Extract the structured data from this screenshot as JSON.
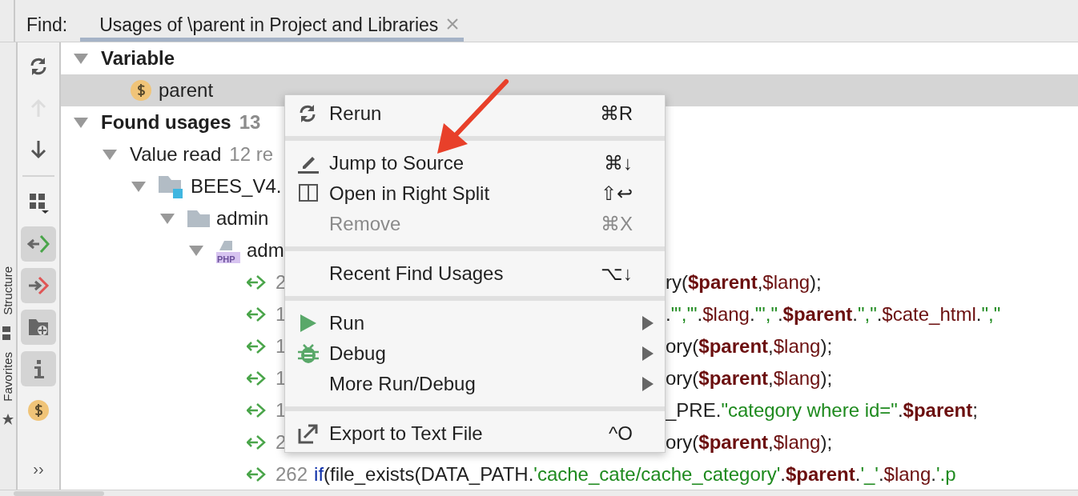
{
  "find_label": "Find:",
  "tab": {
    "label": "Usages of \\parent in Project and Libraries",
    "selected": true
  },
  "side_labels": [
    {
      "label": "Structure",
      "kind": "structure"
    },
    {
      "label": "Favorites",
      "kind": "favorites"
    }
  ],
  "toolbar": [
    {
      "kind": "rerun",
      "pressed": false,
      "disabled": false
    },
    {
      "kind": "up",
      "pressed": false,
      "disabled": true
    },
    {
      "kind": "down",
      "pressed": false,
      "disabled": false
    },
    {
      "kind": "separator"
    },
    {
      "kind": "group",
      "pressed": false,
      "disabled": false
    },
    {
      "kind": "read",
      "pressed": true,
      "disabled": false
    },
    {
      "kind": "write",
      "pressed": true,
      "disabled": false
    },
    {
      "kind": "folder",
      "pressed": true,
      "disabled": false
    },
    {
      "kind": "info",
      "pressed": true,
      "disabled": false
    },
    {
      "kind": "dollar",
      "pressed": false,
      "disabled": false
    }
  ],
  "more": "››",
  "tree": [
    {
      "kind": "heading",
      "label": "Variable",
      "expanded": true,
      "selected": false,
      "children": [
        {
          "kind": "variable",
          "label": "parent",
          "selected": true
        }
      ]
    },
    {
      "kind": "heading",
      "label": "Found usages",
      "count": "13",
      "expanded": true,
      "selected": false,
      "children": [
        {
          "kind": "group",
          "label": "Value read",
          "count": "12 re",
          "expanded": true,
          "selected": false,
          "children": [
            {
              "kind": "module",
              "label": "BEES_V4.",
              "expanded": true,
              "selected": false,
              "children": [
                {
                  "kind": "folder",
                  "label": "admin",
                  "expanded": true,
                  "selected": false,
                  "children": [
                    {
                      "kind": "php",
                      "badge": "PHP",
                      "label": "adm",
                      "expanded": true,
                      "selected": false,
                      "children": [
                        {
                          "kind": "usage",
                          "line": "2",
                          "cut_by_menu": true,
                          "selected": false,
                          "code": [
                            {
                              "kind": "plain",
                              "text": "ry("
                            },
                            {
                              "kind": "hit",
                              "text": "$parent"
                            },
                            {
                              "kind": "plain",
                              "text": ","
                            },
                            {
                              "kind": "var",
                              "text": "$lang"
                            },
                            {
                              "kind": "plain",
                              "text": ");"
                            }
                          ]
                        },
                        {
                          "kind": "usage",
                          "line": "1",
                          "cut_by_menu": true,
                          "selected": false,
                          "code": [
                            {
                              "kind": "plain",
                              "text": "."
                            },
                            {
                              "kind": "string",
                              "text": "\"','\""
                            },
                            {
                              "kind": "plain",
                              "text": "."
                            },
                            {
                              "kind": "var",
                              "text": "$lang"
                            },
                            {
                              "kind": "plain",
                              "text": "."
                            },
                            {
                              "kind": "string",
                              "text": "\"',\""
                            },
                            {
                              "kind": "plain",
                              "text": "."
                            },
                            {
                              "kind": "hit",
                              "text": "$parent"
                            },
                            {
                              "kind": "plain",
                              "text": "."
                            },
                            {
                              "kind": "string",
                              "text": "\",\""
                            },
                            {
                              "kind": "plain",
                              "text": "."
                            },
                            {
                              "kind": "var",
                              "text": "$cate_html"
                            },
                            {
                              "kind": "plain",
                              "text": "."
                            },
                            {
                              "kind": "string",
                              "text": "\",\""
                            }
                          ]
                        },
                        {
                          "kind": "usage",
                          "line": "1",
                          "cut_by_menu": true,
                          "selected": false,
                          "code": [
                            {
                              "kind": "plain",
                              "text": "ory("
                            },
                            {
                              "kind": "hit",
                              "text": "$parent"
                            },
                            {
                              "kind": "plain",
                              "text": ","
                            },
                            {
                              "kind": "var",
                              "text": "$lang"
                            },
                            {
                              "kind": "plain",
                              "text": ");"
                            }
                          ]
                        },
                        {
                          "kind": "usage",
                          "line": "1",
                          "cut_by_menu": true,
                          "selected": false,
                          "code": [
                            {
                              "kind": "plain",
                              "text": "ory("
                            },
                            {
                              "kind": "hit",
                              "text": "$parent"
                            },
                            {
                              "kind": "plain",
                              "text": ","
                            },
                            {
                              "kind": "var",
                              "text": "$lang"
                            },
                            {
                              "kind": "plain",
                              "text": ");"
                            }
                          ]
                        },
                        {
                          "kind": "usage",
                          "line": "1",
                          "cut_by_menu": true,
                          "selected": false,
                          "code": [
                            {
                              "kind": "plain",
                              "text": "_PRE."
                            },
                            {
                              "kind": "string",
                              "text": "\"category where id=\""
                            },
                            {
                              "kind": "plain",
                              "text": "."
                            },
                            {
                              "kind": "hit",
                              "text": "$parent"
                            },
                            {
                              "kind": "plain",
                              "text": ";"
                            }
                          ]
                        },
                        {
                          "kind": "usage",
                          "line": "2",
                          "cut_by_menu": true,
                          "selected": false,
                          "code": [
                            {
                              "kind": "plain",
                              "text": "ory("
                            },
                            {
                              "kind": "hit",
                              "text": "$parent"
                            },
                            {
                              "kind": "plain",
                              "text": ","
                            },
                            {
                              "kind": "var",
                              "text": "$lang"
                            },
                            {
                              "kind": "plain",
                              "text": ");"
                            }
                          ]
                        },
                        {
                          "kind": "usage",
                          "line": "262",
                          "cut_by_menu": false,
                          "selected": false,
                          "code": [
                            {
                              "kind": "keyword",
                              "text": "if"
                            },
                            {
                              "kind": "plain",
                              "text": "(file_exists(DATA_PATH."
                            },
                            {
                              "kind": "string",
                              "text": "'cache_cate/cache_category'"
                            },
                            {
                              "kind": "plain",
                              "text": "."
                            },
                            {
                              "kind": "hit",
                              "text": "$parent"
                            },
                            {
                              "kind": "plain",
                              "text": "."
                            },
                            {
                              "kind": "string",
                              "text": "'_'"
                            },
                            {
                              "kind": "plain",
                              "text": "."
                            },
                            {
                              "kind": "var",
                              "text": "$lang"
                            },
                            {
                              "kind": "plain",
                              "text": "."
                            },
                            {
                              "kind": "string",
                              "text": "'.p"
                            }
                          ]
                        }
                      ]
                    }
                  ]
                }
              ]
            }
          ]
        }
      ]
    }
  ],
  "menu": [
    {
      "kind": "rerun",
      "label": "Rerun",
      "shortcut": "⌘R",
      "disabled": false,
      "submenu": false
    },
    {
      "kind": "separator"
    },
    {
      "kind": "pencil",
      "label": "Jump to Source",
      "shortcut": "⌘↓",
      "disabled": false,
      "submenu": false
    },
    {
      "kind": "split",
      "label": "Open in Right Split",
      "shortcut": "⇧↩",
      "disabled": false,
      "submenu": false
    },
    {
      "kind": "plain",
      "label": "Remove",
      "shortcut": "⌘X",
      "disabled": true,
      "submenu": false
    },
    {
      "kind": "separator"
    },
    {
      "kind": "plain",
      "label": "Recent Find Usages",
      "shortcut": "⌥↓",
      "disabled": false,
      "submenu": false
    },
    {
      "kind": "separator"
    },
    {
      "kind": "run",
      "label": "Run",
      "disabled": false,
      "submenu": true
    },
    {
      "kind": "bug",
      "label": "Debug",
      "disabled": false,
      "submenu": true
    },
    {
      "kind": "plain",
      "label": "More Run/Debug",
      "disabled": false,
      "submenu": true
    },
    {
      "kind": "separator"
    },
    {
      "kind": "export",
      "label": "Export to Text File",
      "shortcut": "^O",
      "disabled": false,
      "submenu": false
    }
  ]
}
